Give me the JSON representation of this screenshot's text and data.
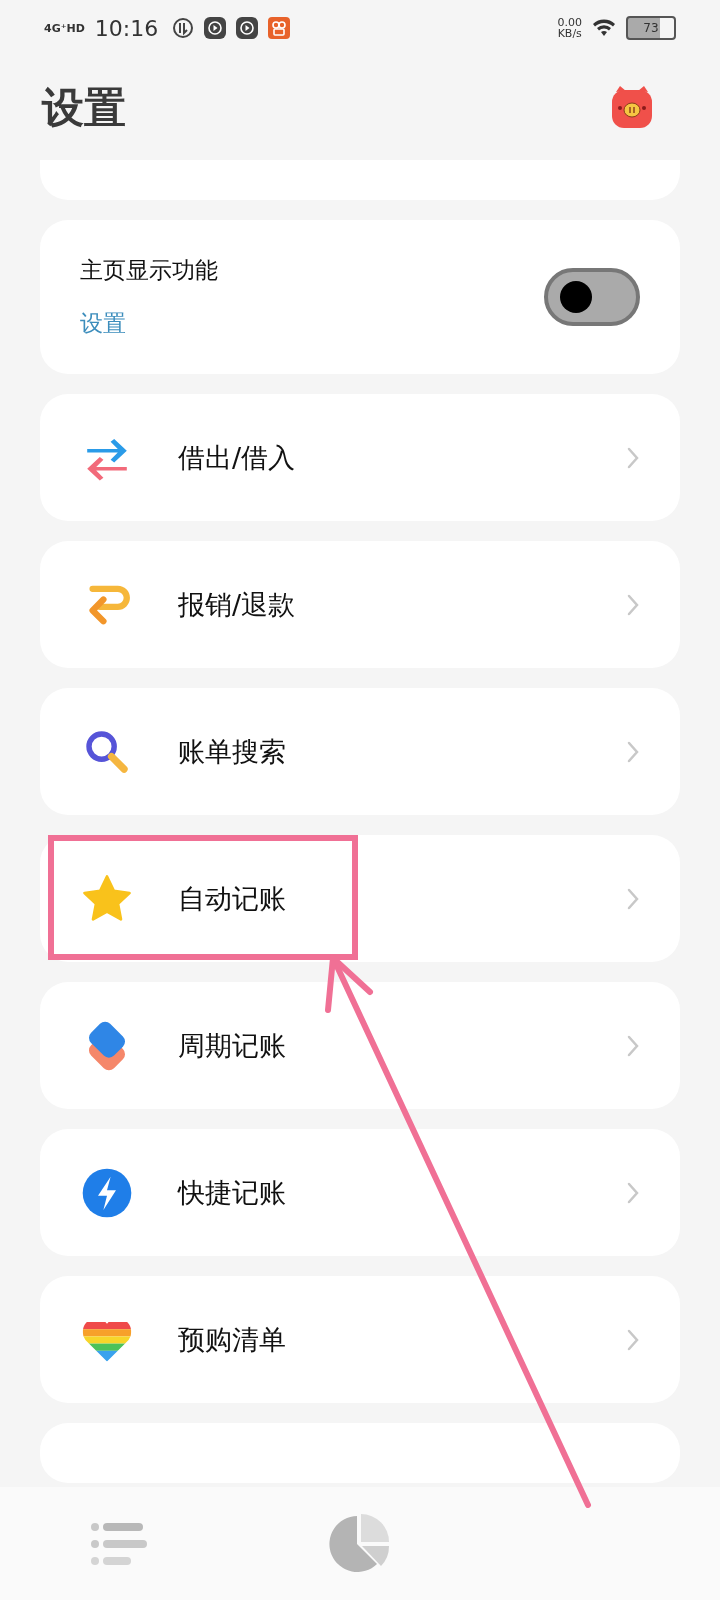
{
  "status_bar": {
    "network": "4G⁺HD",
    "time": "10:16",
    "speed": "0.00",
    "speed_unit": "KB/s",
    "battery": "73"
  },
  "header": {
    "title": "设置"
  },
  "home_display": {
    "label": "主页显示功能",
    "link": "设置",
    "on": false
  },
  "items": [
    {
      "kind": "exchange",
      "label": "借出/借入",
      "highlighted": false
    },
    {
      "kind": "refund",
      "label": "报销/退款",
      "highlighted": false
    },
    {
      "kind": "search",
      "label": "账单搜索",
      "highlighted": false
    },
    {
      "kind": "star",
      "label": "自动记账",
      "highlighted": true
    },
    {
      "kind": "layers",
      "label": "周期记账",
      "highlighted": false
    },
    {
      "kind": "bolt",
      "label": "快捷记账",
      "highlighted": false
    },
    {
      "kind": "heart",
      "label": "预购清单",
      "highlighted": false
    }
  ]
}
